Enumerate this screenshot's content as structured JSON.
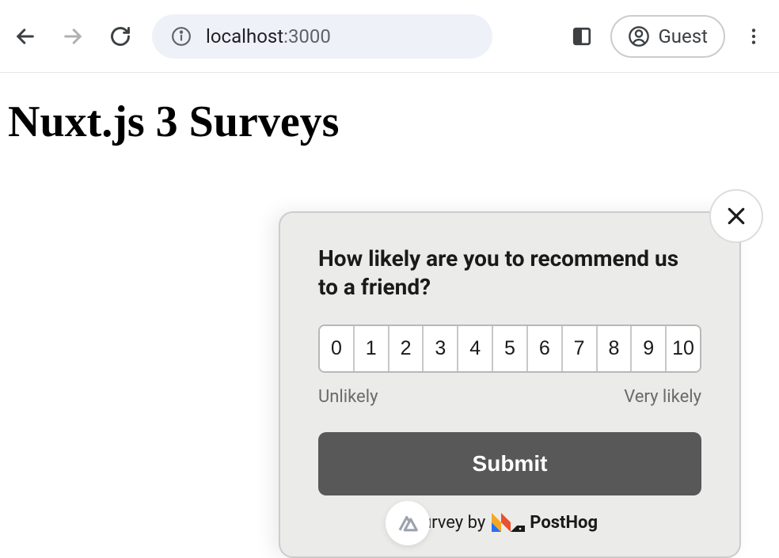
{
  "browser": {
    "url_host": "localhost",
    "url_port": ":3000",
    "guest_label": "Guest"
  },
  "page": {
    "title": "Nuxt.js 3 Surveys"
  },
  "survey": {
    "question": "How likely are you to recommend us to a friend?",
    "ratings": [
      "0",
      "1",
      "2",
      "3",
      "4",
      "5",
      "6",
      "7",
      "8",
      "9",
      "10"
    ],
    "label_low": "Unlikely",
    "label_high": "Very likely",
    "submit_label": "Submit",
    "footer_prefix": "urvey by",
    "footer_brand": "PostHog"
  }
}
